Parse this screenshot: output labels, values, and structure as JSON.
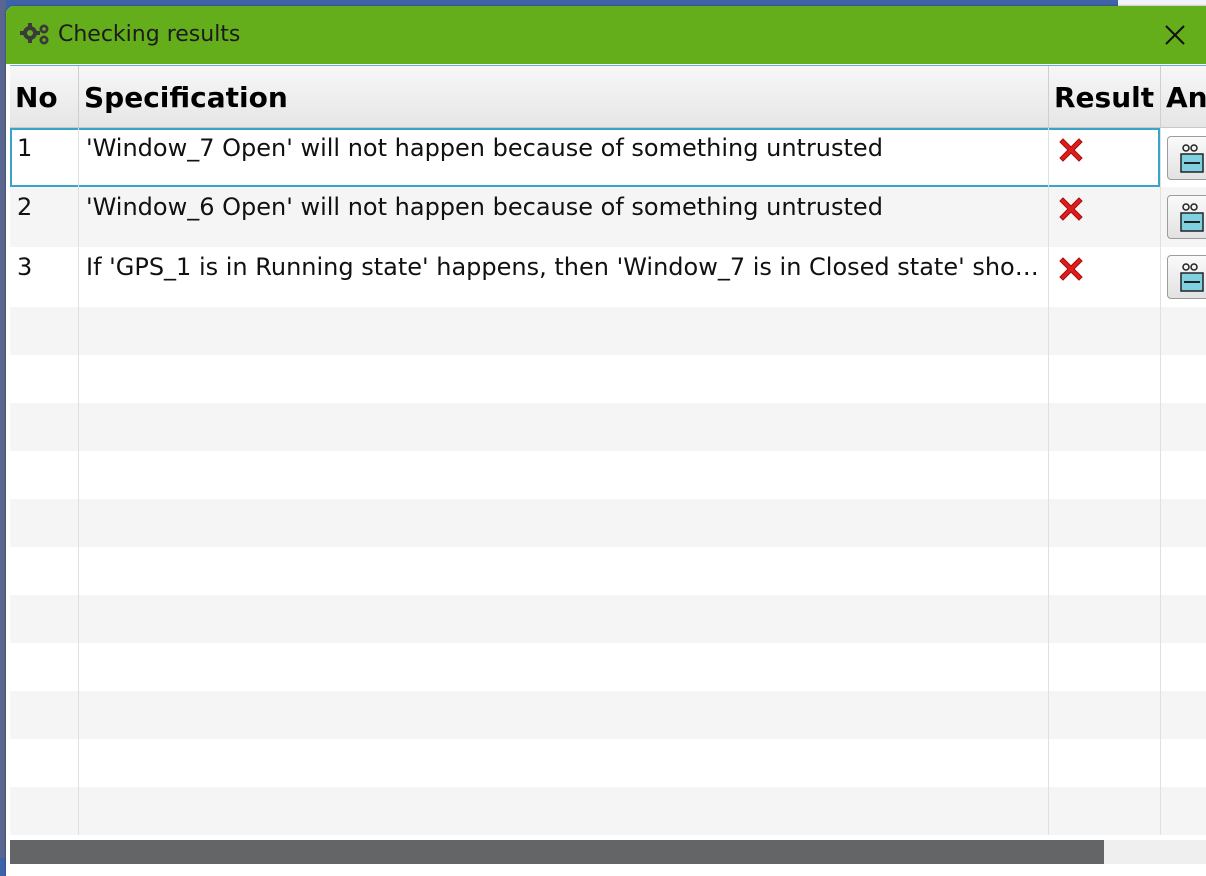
{
  "window": {
    "title": "Checking results"
  },
  "table": {
    "columns": [
      "No",
      "Specification",
      "Result",
      "An"
    ],
    "rows": [
      {
        "no": "1",
        "specification": "'Window_7 Open' will not happen because of something untrusted",
        "result": "fail-x-icon",
        "selected": true
      },
      {
        "no": "2",
        "specification": "'Window_6 Open' will not happen because of something untrusted",
        "result": "fail-x-icon",
        "selected": false
      },
      {
        "no": "3",
        "specification": "If 'GPS_1 is in Running state' happens, then 'Window_7 is in Closed state' should …",
        "result": "fail-x-icon",
        "selected": false
      }
    ]
  },
  "colors": {
    "titlebar": "#64ad1b",
    "selection": "#3aa3c9",
    "fail": "#e01c1c"
  }
}
